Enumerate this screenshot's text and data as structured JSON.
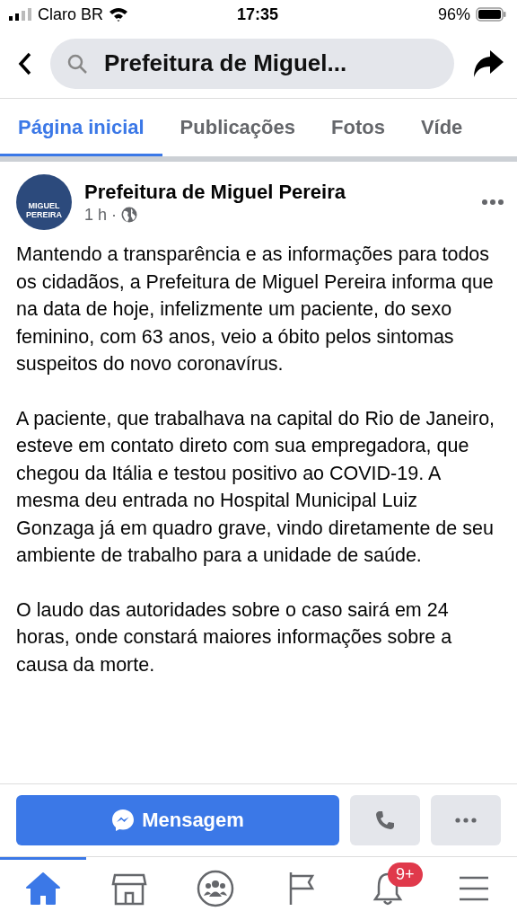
{
  "status_bar": {
    "carrier": "Claro BR",
    "time": "17:35",
    "battery": "96%"
  },
  "search": {
    "value": "Prefeitura de Miguel..."
  },
  "tabs": [
    {
      "label": "Página inicial",
      "selected": true
    },
    {
      "label": "Publicações",
      "selected": false
    },
    {
      "label": "Fotos",
      "selected": false
    },
    {
      "label": "Víde",
      "selected": false
    }
  ],
  "post": {
    "avatar_lines": [
      "MIGUEL",
      "PEREIRA"
    ],
    "author": "Prefeitura de Miguel Pereira",
    "time": "1 h",
    "separator": "·",
    "paragraphs": [
      "Mantendo a transparência e as informações para todos os cidadãos, a Prefeitura de Miguel Pereira informa que na data de hoje, infelizmente um paciente, do sexo feminino, com 63 anos, veio a óbito pelos sintomas suspeitos do novo coronavírus.",
      "A paciente, que trabalhava na capital do Rio de Janeiro, esteve em contato direto com sua empregadora, que chegou da Itália e testou positivo ao COVID-19. A mesma deu entrada no Hospital Municipal Luiz Gonzaga já em quadro grave, vindo diretamente de seu ambiente de trabalho para a unidade de saúde.",
      "O laudo das autoridades sobre o caso sairá em 24 horas, onde constará maiores informações sobre a causa da morte."
    ]
  },
  "actions": {
    "message": "Mensagem"
  },
  "bottom_nav": [
    {
      "kind": "home",
      "selected": true
    },
    {
      "kind": "store",
      "selected": false
    },
    {
      "kind": "groups",
      "selected": false
    },
    {
      "kind": "flag",
      "selected": false
    },
    {
      "kind": "bell",
      "selected": false,
      "badge": "9+"
    },
    {
      "kind": "menu",
      "selected": false
    }
  ]
}
